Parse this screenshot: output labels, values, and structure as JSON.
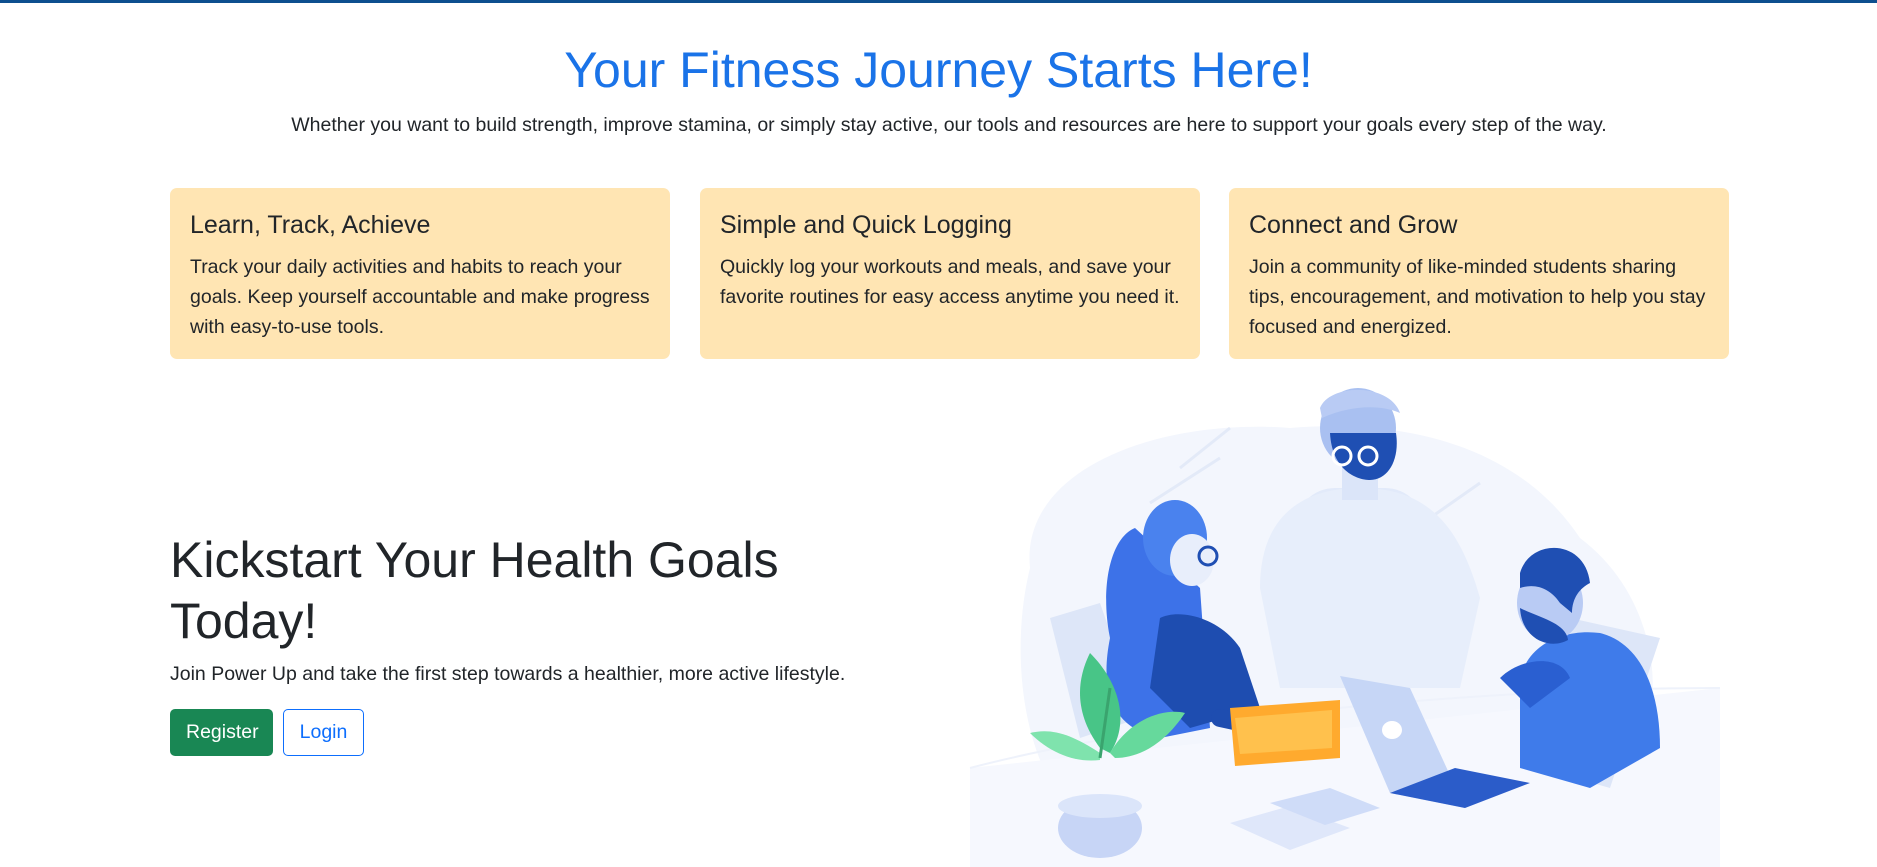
{
  "hero": {
    "title": "Your Fitness Journey Starts Here!",
    "subtitle": "Whether you want to build strength, improve stamina, or simply stay active, our tools and resources are here to support your goals every step of the way."
  },
  "features": [
    {
      "title": "Learn, Track, Achieve",
      "text": "Track your daily activities and habits to reach your goals. Keep yourself accountable and make progress with easy-to-use tools."
    },
    {
      "title": "Simple and Quick Logging",
      "text": "Quickly log your workouts and meals, and save your favorite routines for easy access anytime you need it."
    },
    {
      "title": "Connect and Grow",
      "text": "Join a community of like-minded students sharing tips, encouragement, and motivation to help you stay focused and energized."
    }
  ],
  "cta": {
    "title": "Kickstart Your Health Goals Today!",
    "text": "Join Power Up and take the first step towards a healthier, more active lifestyle.",
    "register_label": "Register",
    "login_label": "Login"
  },
  "colors": {
    "accent_blue": "#1a73e8",
    "card_background": "#ffe5b3",
    "register_green": "#198754",
    "login_blue": "#0d6efd",
    "top_bar": "#0d4f8f"
  },
  "illustration": {
    "icon": "team-collaboration-illustration"
  }
}
